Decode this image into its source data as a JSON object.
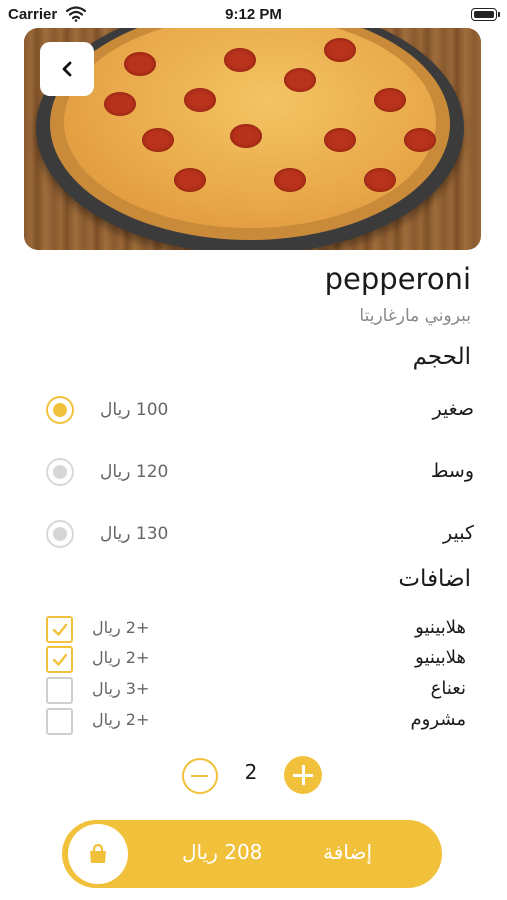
{
  "status_bar": {
    "carrier": "Carrier",
    "time": "9:12 PM"
  },
  "product": {
    "name": "pepperoni",
    "subtitle": "ببروني مارغاريتا"
  },
  "size_section": {
    "title": "الحجم",
    "options": [
      {
        "label": "صغير",
        "price": "100 ريال",
        "selected": true
      },
      {
        "label": "وسط",
        "price": "120 ريال",
        "selected": false
      },
      {
        "label": "كبير",
        "price": "130 ريال",
        "selected": false
      }
    ]
  },
  "addons_section": {
    "title": "اضافات",
    "items": [
      {
        "label": "هلابينيو",
        "price": "+2 ريال",
        "checked": true
      },
      {
        "label": "هلابينيو",
        "price": "+2 ريال",
        "checked": true
      },
      {
        "label": "نعناع",
        "price": "+3 ريال",
        "checked": false
      },
      {
        "label": "مشروم",
        "price": "+2 ريال",
        "checked": false
      }
    ]
  },
  "quantity": {
    "value": "2"
  },
  "add_button": {
    "label": "إضافة",
    "total": "208 ريال"
  },
  "colors": {
    "accent": "#f2c13c",
    "muted": "#d8d8d8"
  },
  "icons": {
    "back": "chevron-left-icon",
    "wifi": "wifi-icon",
    "battery": "battery-icon",
    "cart": "shopping-bag-icon"
  }
}
